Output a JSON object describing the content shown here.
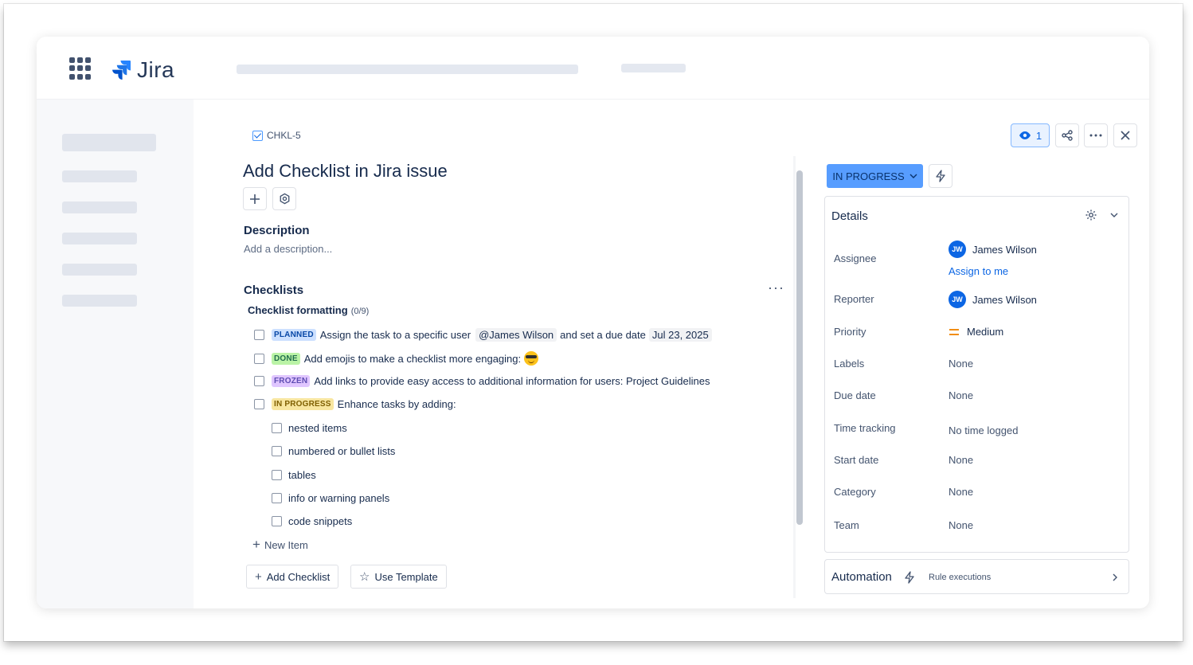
{
  "app": {
    "name": "Jira"
  },
  "issue": {
    "key": "CHKL-5",
    "title": "Add Checklist in Jira issue",
    "description_heading": "Description",
    "description_placeholder": "Add a description..."
  },
  "checklists": {
    "heading": "Checklists",
    "more_label": "···",
    "list_title": "Checklist formatting",
    "count": "(0/9)",
    "items": [
      {
        "status": "PLANNED",
        "text_before": "Assign the task to a specific user",
        "mention": "@James Wilson",
        "text_mid": "and set a due date",
        "date": "Jul 23, 2025"
      },
      {
        "status": "DONE",
        "text": "Add emojis to make a checklist more engaging:"
      },
      {
        "status": "FROZEN",
        "text": "Add links to provide easy access to additional information for users: Project Guidelines"
      },
      {
        "status": "IN PROGRESS",
        "text": "Enhance tasks by adding:"
      }
    ],
    "sub_items": [
      "nested items",
      "numbered or bullet lists",
      "tables",
      "info or warning panels",
      "code snippets"
    ],
    "new_item_label": "New Item",
    "add_checklist_label": "Add Checklist",
    "use_template_label": "Use Template"
  },
  "toolbar": {
    "watch_count": "1"
  },
  "status": {
    "label": "IN PROGRESS"
  },
  "details": {
    "title": "Details",
    "assignee_label": "Assignee",
    "assignee_initials": "JW",
    "assignee_name": "James Wilson",
    "assign_to_me": "Assign to me",
    "reporter_label": "Reporter",
    "reporter_initials": "JW",
    "reporter_name": "James Wilson",
    "priority_label": "Priority",
    "priority_value": "Medium",
    "labels_label": "Labels",
    "labels_value": "None",
    "due_date_label": "Due date",
    "due_date_value": "None",
    "time_tracking_label": "Time tracking",
    "time_tracking_value": "No time logged",
    "start_date_label": "Start date",
    "start_date_value": "None",
    "category_label": "Category",
    "category_value": "None",
    "team_label": "Team",
    "team_value": "None"
  },
  "automation": {
    "title": "Automation",
    "rule_executions": "Rule executions"
  },
  "colors": {
    "accent": "#0c66e4",
    "status_bg": "#579dff"
  }
}
